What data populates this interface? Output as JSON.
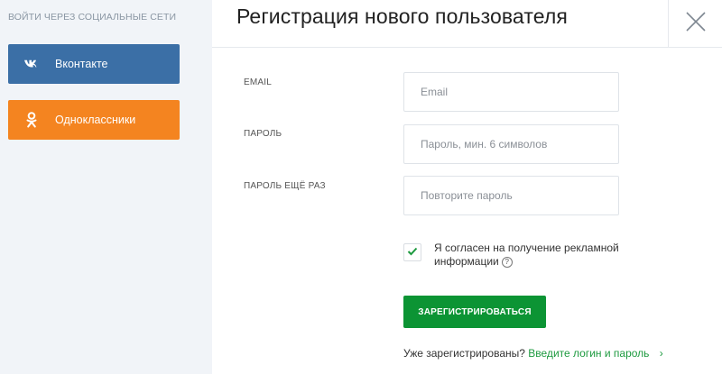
{
  "social": {
    "title": "Войти через социальные сети",
    "buttons": [
      {
        "label": "Вконтакте",
        "icon": "vk-icon",
        "color": "#3b6fa6"
      },
      {
        "label": "Одноклассники",
        "icon": "odnoklassniki-icon",
        "color": "#f48420"
      }
    ]
  },
  "form": {
    "title": "Регистрация нового пользователя",
    "fields": [
      {
        "label": "EMAIL",
        "placeholder": "Email",
        "value": ""
      },
      {
        "label": "ПАРОЛЬ",
        "placeholder": "Пароль, мин. 6 символов",
        "value": ""
      },
      {
        "label": "ПАРОЛЬ ЕЩЁ РАЗ",
        "placeholder": "Повторите пароль",
        "value": ""
      }
    ],
    "agree": {
      "text": "Я согласен на получение рекламной информации",
      "checked": true
    },
    "submit_label": "Зарегистрироваться",
    "already": {
      "text": "Уже зарегистрированы?",
      "link": "Введите логин и пароль"
    }
  },
  "colors": {
    "accent": "#0c9434",
    "link": "#1d9a3f",
    "vk": "#3b6fa6",
    "ok": "#f48420"
  }
}
